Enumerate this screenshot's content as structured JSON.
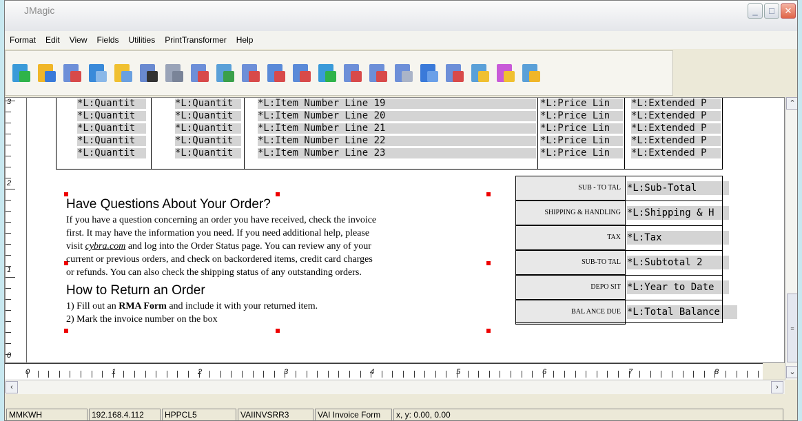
{
  "window": {
    "title": "JMagic"
  },
  "menu": [
    "Format",
    "Edit",
    "View",
    "Fields",
    "Utilities",
    "PrintTransformer",
    "Help"
  ],
  "toolbar_icons": [
    {
      "name": "new-form-icon",
      "c1": "#3a9ad9",
      "c2": "#2fb34a"
    },
    {
      "name": "open-form-icon",
      "c1": "#f0b628",
      "c2": "#3a7ad9"
    },
    {
      "name": "save-form-icon",
      "c1": "#6d8fd8",
      "c2": "#d84a4a"
    },
    {
      "name": "print-transform-icon",
      "c1": "#3a8ad9",
      "c2": "#8ab8e8"
    },
    {
      "name": "database-icon",
      "c1": "#f0c030",
      "c2": "#6aa0e0"
    },
    {
      "name": "barcode-icon",
      "c1": "#6a8ad0",
      "c2": "#333333"
    },
    {
      "name": "copy-icon",
      "c1": "#9aa4b8",
      "c2": "#7a8498"
    },
    {
      "name": "text-field-icon",
      "c1": "#6d8fd8",
      "c2": "#d84a4a"
    },
    {
      "name": "text-field-abc-icon",
      "c1": "#5aa0d8",
      "c2": "#3aa04a"
    },
    {
      "name": "field-box-icon",
      "c1": "#6d8fd8",
      "c2": "#d84a4a"
    },
    {
      "name": "rectangle-icon",
      "c1": "#5a8ad8",
      "c2": "#d84a4a"
    },
    {
      "name": "line-icon",
      "c1": "#5a8ad8",
      "c2": "#d84a4a"
    },
    {
      "name": "insert-image-icon",
      "c1": "#3a9ad9",
      "c2": "#2fb34a"
    },
    {
      "name": "list-icon",
      "c1": "#6d8fd8",
      "c2": "#d84a4a"
    },
    {
      "name": "properties-icon",
      "c1": "#6d8fd8",
      "c2": "#d84a4a"
    },
    {
      "name": "document-icon",
      "c1": "#6d8fd8",
      "c2": "#aab4c8"
    },
    {
      "name": "grid-icon",
      "c1": "#3a7ad9",
      "c2": "#6aa0e8"
    },
    {
      "name": "delete-icon",
      "c1": "#6d8fd8",
      "c2": "#d84a4a"
    },
    {
      "name": "select-icon",
      "c1": "#5aa0d8",
      "c2": "#f0c030"
    },
    {
      "name": "undo-icon",
      "c1": "#c85ad8",
      "c2": "#f0c030"
    },
    {
      "name": "redo-icon",
      "c1": "#5aa0d8",
      "c2": "#f0b628"
    }
  ],
  "ruler": {
    "vertical": [
      "3",
      "2",
      "1",
      "0"
    ],
    "horizontal": [
      "0",
      "1",
      "2",
      "3",
      "4",
      "5",
      "6",
      "7",
      "8"
    ]
  },
  "line_items": [
    {
      "qty1": "*L:Quantit",
      "qty2": "*L:Quantit",
      "item": "*L:Item Number Line 19",
      "price": "*L:Price Lin",
      "ext": "*L:Extended P"
    },
    {
      "qty1": "*L:Quantit",
      "qty2": "*L:Quantit",
      "item": "*L:Item Number Line 20",
      "price": "*L:Price Lin",
      "ext": "*L:Extended P"
    },
    {
      "qty1": "*L:Quantit",
      "qty2": "*L:Quantit",
      "item": "*L:Item Number Line 21",
      "price": "*L:Price Lin",
      "ext": "*L:Extended P"
    },
    {
      "qty1": "*L:Quantit",
      "qty2": "*L:Quantit",
      "item": "*L:Item Number Line 22",
      "price": "*L:Price Lin",
      "ext": "*L:Extended P"
    },
    {
      "qty1": "*L:Quantit",
      "qty2": "*L:Quantit",
      "item": "*L:Item Number Line 23",
      "price": "*L:Price Lin",
      "ext": "*L:Extended P"
    }
  ],
  "questions": {
    "heading": "Have Questions About Your Order?",
    "lines": [
      "If you have a question concerning an order you have received, check the invoice",
      "first. It may have the information you need.  If you need additional help, please",
      "and log into the Order Status page. You can review any of your",
      "current or previous orders, and check on backordered items, credit card charges",
      "or refunds. You can also check the shipping status of any outstanding orders."
    ],
    "visit_prefix": "visit ",
    "link": "cybra.com"
  },
  "return": {
    "heading": "How to Return an Order",
    "step1_prefix": "1) Fill out an ",
    "step1_bold": "RMA Form",
    "step1_suffix": " and include it with your returned item.",
    "step2": "2) Mark the invoice number on the box"
  },
  "totals": [
    {
      "label": "SUB - TO TAL",
      "value": "*L:Sub-Total"
    },
    {
      "label": "SHIPPING & HANDLING",
      "value": "*L:Shipping & H"
    },
    {
      "label": "TAX",
      "value": "*L:Tax"
    },
    {
      "label": "SUB-TO TAL",
      "value": "*L:Subtotal 2"
    },
    {
      "label": "DEPO SIT",
      "value": "*L:Year to Date"
    },
    {
      "label": "BAL ANCE DUE",
      "value": "*L:Total Balance"
    }
  ],
  "status": {
    "user": "MMKWH",
    "ip": "192.168.4.112",
    "driver": "HPPCL5",
    "library": "VAIINVSRR3",
    "form": "VAI Invoice Form",
    "coords": "x, y:  0.00,  0.00"
  }
}
